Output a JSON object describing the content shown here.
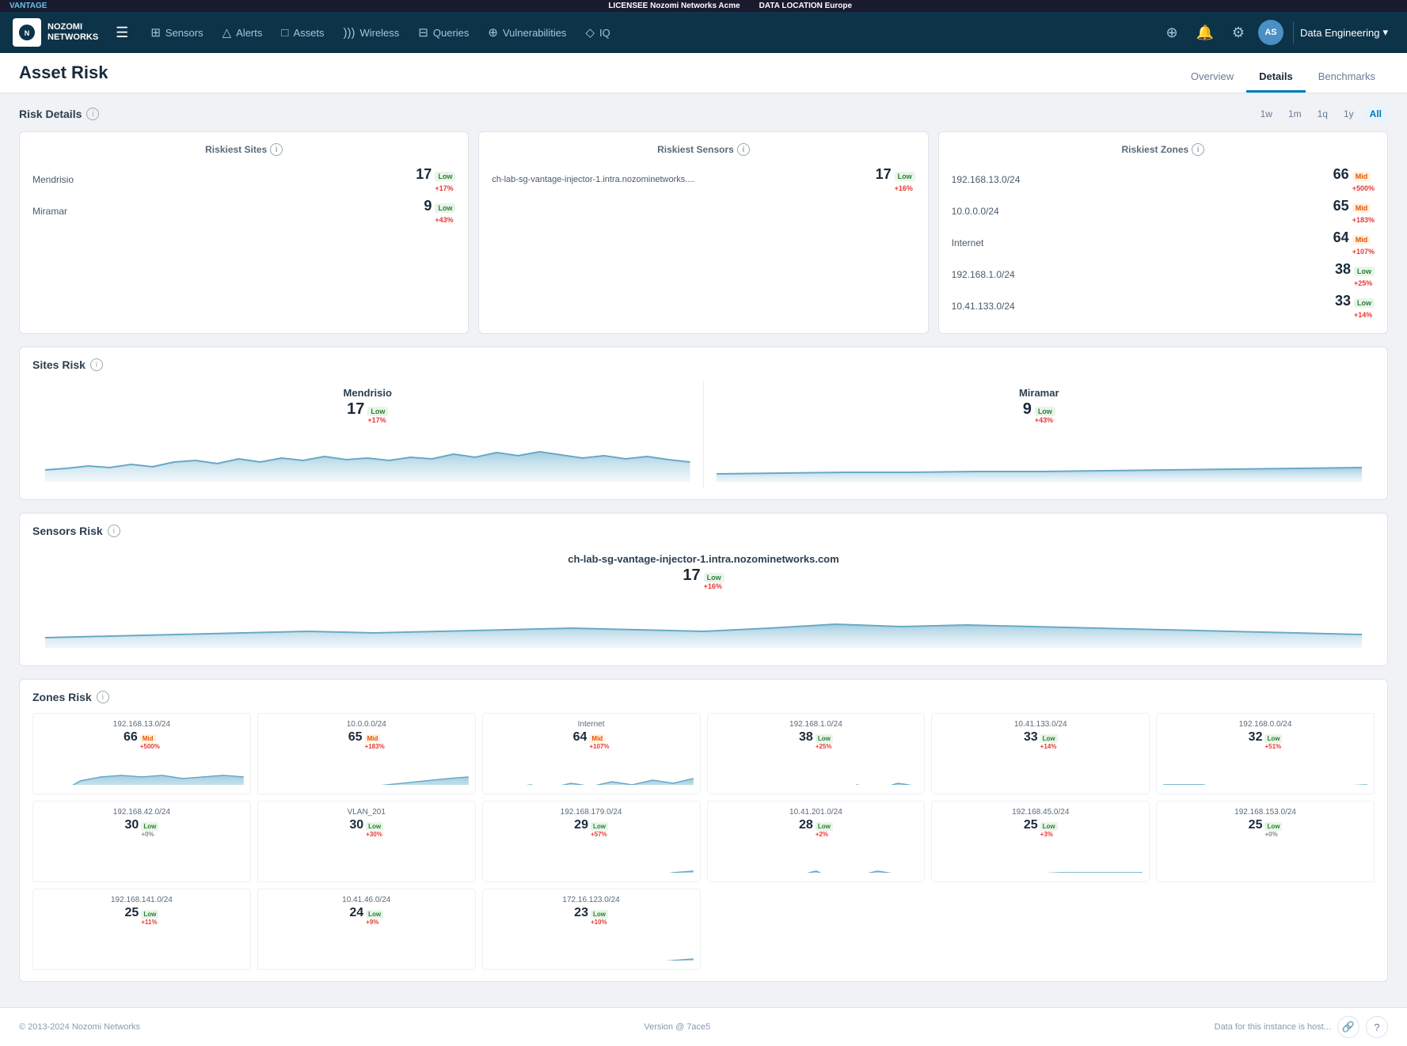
{
  "topBanner": {
    "vantage": "VANTAGE",
    "licenseeLabel": "LICENSEE",
    "licenseeName": "Nozomi Networks Acme",
    "dataLocationLabel": "DATA LOCATION",
    "dataLocationValue": "Europe"
  },
  "navbar": {
    "logoLine1": "NOZOMI",
    "logoLine2": "NETWORKS",
    "menuItems": [
      {
        "label": "Sensors",
        "icon": "📡"
      },
      {
        "label": "Alerts",
        "icon": "🔔"
      },
      {
        "label": "Assets",
        "icon": "🖥"
      },
      {
        "label": "Wireless",
        "icon": "📶"
      },
      {
        "label": "Queries",
        "icon": "🗄"
      },
      {
        "label": "Vulnerabilities",
        "icon": "🛡"
      },
      {
        "label": "IQ",
        "icon": "💡"
      }
    ],
    "avatarInitials": "AS",
    "dataEngLabel": "Data Engineering"
  },
  "pageHeader": {
    "title": "Asset Risk",
    "tabs": [
      "Overview",
      "Details",
      "Benchmarks"
    ],
    "activeTab": "Details"
  },
  "riskDetails": {
    "sectionTitle": "Risk Details",
    "timeFilters": [
      "1w",
      "1m",
      "1q",
      "1y",
      "All"
    ],
    "activeFilter": "All"
  },
  "riskiestSites": {
    "title": "Riskiest Sites",
    "rows": [
      {
        "label": "Mendrisio",
        "value": "17",
        "badge": "Low",
        "change": "+17%"
      },
      {
        "label": "Miramar",
        "value": "9",
        "badge": "Low",
        "change": "+43%"
      }
    ]
  },
  "riskiestSensors": {
    "title": "Riskiest Sensors",
    "rows": [
      {
        "label": "ch-lab-sg-vantage-injector-1.intra.nozominetworks....",
        "value": "17",
        "badge": "Low",
        "change": "+16%"
      }
    ]
  },
  "riskiestZones": {
    "title": "Riskiest Zones",
    "rows": [
      {
        "label": "192.168.13.0/24",
        "value": "66",
        "badge": "Mid",
        "change": "+500%"
      },
      {
        "label": "10.0.0.0/24",
        "value": "65",
        "badge": "Mid",
        "change": "+183%"
      },
      {
        "label": "Internet",
        "value": "64",
        "badge": "Mid",
        "change": "+107%"
      },
      {
        "label": "192.168.1.0/24",
        "value": "38",
        "badge": "Low",
        "change": "+25%"
      },
      {
        "label": "10.41.133.0/24",
        "value": "33",
        "badge": "Low",
        "change": "+14%"
      }
    ]
  },
  "sitesRisk": {
    "title": "Sites Risk",
    "sites": [
      {
        "name": "Mendrisio",
        "value": "17",
        "badge": "Low",
        "change": "+17%"
      },
      {
        "name": "Miramar",
        "value": "9",
        "badge": "Low",
        "change": "+43%"
      }
    ]
  },
  "sensorsRisk": {
    "title": "Sensors Risk",
    "sensor": {
      "name": "ch-lab-sg-vantage-injector-1.intra.nozominetworks.com",
      "value": "17",
      "badge": "Low",
      "change": "+16%"
    }
  },
  "zonesRisk": {
    "title": "Zones Risk",
    "zones": [
      {
        "name": "192.168.13.0/24",
        "value": "66",
        "badge": "Mid",
        "change": "+500%",
        "changeColor": "red"
      },
      {
        "name": "10.0.0.0/24",
        "value": "65",
        "badge": "Mid",
        "change": "+183%",
        "changeColor": "red"
      },
      {
        "name": "Internet",
        "value": "64",
        "badge": "Mid",
        "change": "+107%",
        "changeColor": "red"
      },
      {
        "name": "192.168.1.0/24",
        "value": "38",
        "badge": "Low",
        "change": "+25%",
        "changeColor": "red"
      },
      {
        "name": "10.41.133.0/24",
        "value": "33",
        "badge": "Low",
        "change": "+14%",
        "changeColor": "red"
      },
      {
        "name": "192.168.0.0/24",
        "value": "32",
        "badge": "Low",
        "change": "+51%",
        "changeColor": "red"
      },
      {
        "name": "192.168.42.0/24",
        "value": "30",
        "badge": "Low",
        "change": "+0%",
        "changeColor": "neutral"
      },
      {
        "name": "VLAN_201",
        "value": "30",
        "badge": "Low",
        "change": "+30%",
        "changeColor": "red"
      },
      {
        "name": "192.168.179.0/24",
        "value": "29",
        "badge": "Low",
        "change": "+57%",
        "changeColor": "red"
      },
      {
        "name": "10.41.201.0/24",
        "value": "28",
        "badge": "Low",
        "change": "+2%",
        "changeColor": "red"
      },
      {
        "name": "192.168.45.0/24",
        "value": "25",
        "badge": "Low",
        "change": "+3%",
        "changeColor": "red"
      },
      {
        "name": "192.168.153.0/24",
        "value": "25",
        "badge": "Low",
        "change": "+0%",
        "changeColor": "neutral"
      },
      {
        "name": "192.168.141.0/24",
        "value": "25",
        "badge": "Low",
        "change": "+11%",
        "changeColor": "red"
      },
      {
        "name": "10.41.46.0/24",
        "value": "24",
        "badge": "Low",
        "change": "+9%",
        "changeColor": "red"
      },
      {
        "name": "172.16.123.0/24",
        "value": "23",
        "badge": "Low",
        "change": "+10%",
        "changeColor": "red"
      }
    ]
  },
  "footer": {
    "copyright": "© 2013-2024 Nozomi Networks",
    "version": "Version @ 7ace5",
    "dataInfo": "Data for this instance is host..."
  }
}
